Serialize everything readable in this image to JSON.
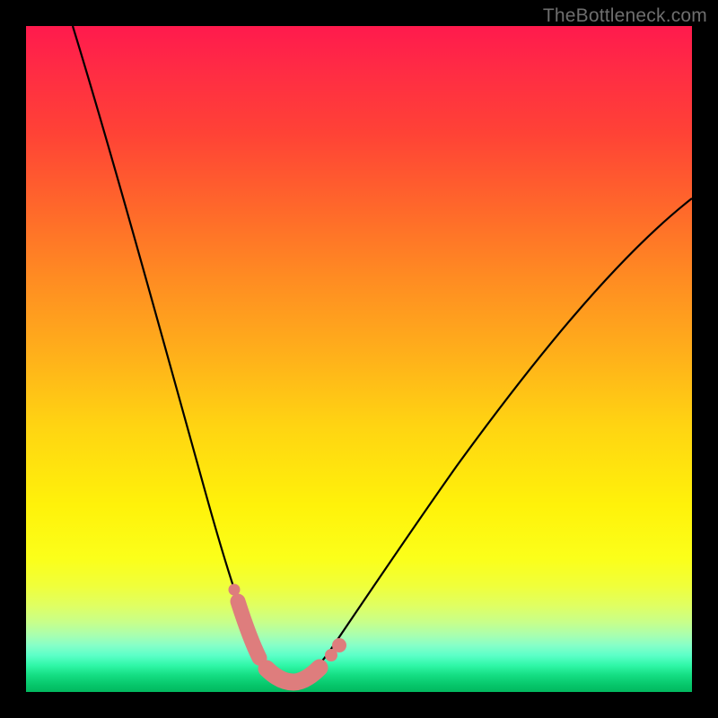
{
  "watermark": "TheBottleneck.com",
  "colors": {
    "frame": "#000000",
    "curve_stroke": "#000000",
    "segment_stroke": "#de7d7d",
    "gradient_top": "#ff1a4d",
    "gradient_bottom": "#02b85f"
  },
  "chart_data": {
    "type": "line",
    "title": "",
    "xlabel": "",
    "ylabel": "",
    "xlim": [
      0,
      100
    ],
    "ylim": [
      0,
      100
    ],
    "grid": false,
    "series": [
      {
        "name": "bottleneck-curve",
        "x": [
          7,
          10,
          13,
          16,
          19,
          22,
          25,
          27,
          29,
          30,
          31,
          32,
          33,
          34,
          35,
          36,
          37,
          38,
          39.5,
          41,
          43,
          46,
          50,
          55,
          60,
          66,
          73,
          80,
          88,
          97
        ],
        "y": [
          100,
          88,
          77,
          66,
          56,
          46,
          36,
          28,
          20,
          16,
          13,
          10,
          7,
          5,
          3.5,
          2.3,
          1.5,
          1,
          0.7,
          0.7,
          1.3,
          3,
          7,
          13,
          20,
          28,
          37,
          46,
          55,
          63
        ]
      }
    ],
    "highlight_segments": [
      {
        "name": "left-band",
        "x": [
          31.2,
          33.8
        ],
        "y": [
          12.0,
          4.5
        ]
      },
      {
        "name": "trough",
        "x": [
          35.0,
          41.5
        ],
        "y": [
          2.1,
          0.9
        ]
      },
      {
        "name": "right-band",
        "x": [
          44.0,
          46.5
        ],
        "y": [
          2.0,
          3.5
        ]
      }
    ]
  }
}
